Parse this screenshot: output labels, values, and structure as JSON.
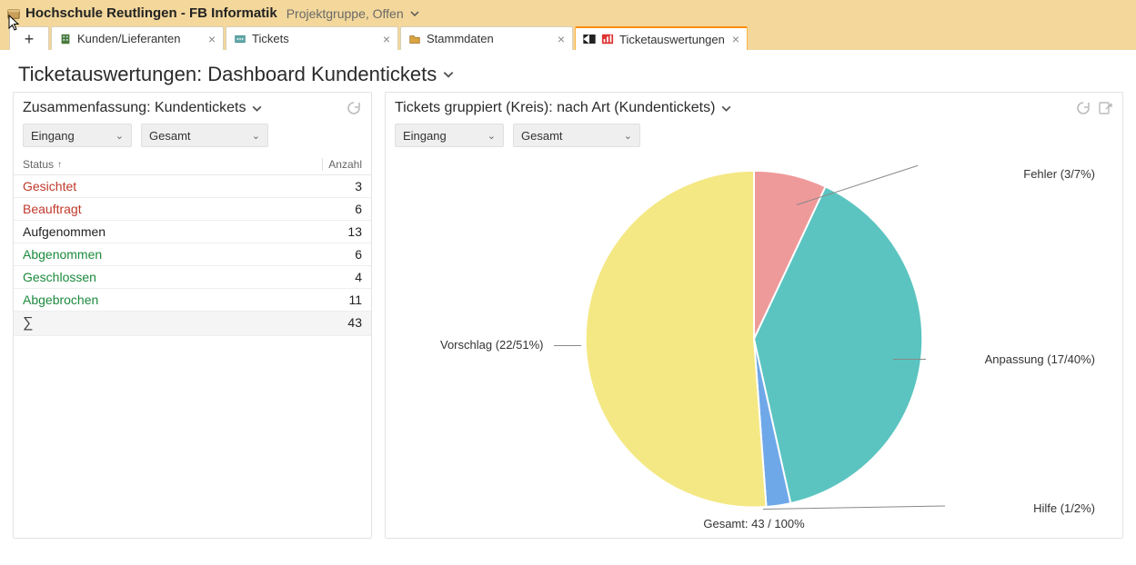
{
  "header": {
    "app_title": "Hochschule Reutlingen - FB Informatik",
    "subtitle": "Projektgruppe, Offen"
  },
  "tabs": [
    {
      "label": "Kunden/Lieferanten",
      "active": false
    },
    {
      "label": "Tickets",
      "active": false
    },
    {
      "label": "Stammdaten",
      "active": false
    },
    {
      "label": "Ticketauswertungen",
      "active": true
    }
  ],
  "page_title": "Ticketauswertungen: Dashboard Kundentickets",
  "summary_panel": {
    "title": "Zusammenfassung: Kundentickets",
    "filter1": "Eingang",
    "filter2": "Gesamt",
    "col_status": "Status",
    "col_count": "Anzahl",
    "rows": [
      {
        "status": "Gesichtet",
        "count": 3,
        "cls": "red"
      },
      {
        "status": "Beauftragt",
        "count": 6,
        "cls": "red"
      },
      {
        "status": "Aufgenommen",
        "count": 13,
        "cls": "black"
      },
      {
        "status": "Abgenommen",
        "count": 6,
        "cls": "green"
      },
      {
        "status": "Geschlossen",
        "count": 4,
        "cls": "green"
      },
      {
        "status": "Abgebrochen",
        "count": 11,
        "cls": "green"
      }
    ],
    "sum_label": "∑",
    "sum_value": 43
  },
  "chart_panel": {
    "title": "Tickets gruppiert (Kreis): nach Art (Kundentickets)",
    "filter1": "Eingang",
    "filter2": "Gesamt",
    "total_label": "Gesamt: 43 / 100%",
    "labels": {
      "fehler": "Fehler (3/7%)",
      "anpassung": "Anpassung (17/40%)",
      "hilfe": "Hilfe (1/2%)",
      "vorschlag": "Vorschlag (22/51%)"
    }
  },
  "chart_data": {
    "type": "pie",
    "title": "Tickets gruppiert (Kreis): nach Art (Kundentickets)",
    "total": 43,
    "series": [
      {
        "name": "Fehler",
        "value": 3,
        "pct": 7,
        "color": "#ef9a9a"
      },
      {
        "name": "Anpassung",
        "value": 17,
        "pct": 40,
        "color": "#5bc4c0"
      },
      {
        "name": "Hilfe",
        "value": 1,
        "pct": 2,
        "color": "#6fa8e8"
      },
      {
        "name": "Vorschlag",
        "value": 22,
        "pct": 51,
        "color": "#f4e884"
      }
    ]
  }
}
